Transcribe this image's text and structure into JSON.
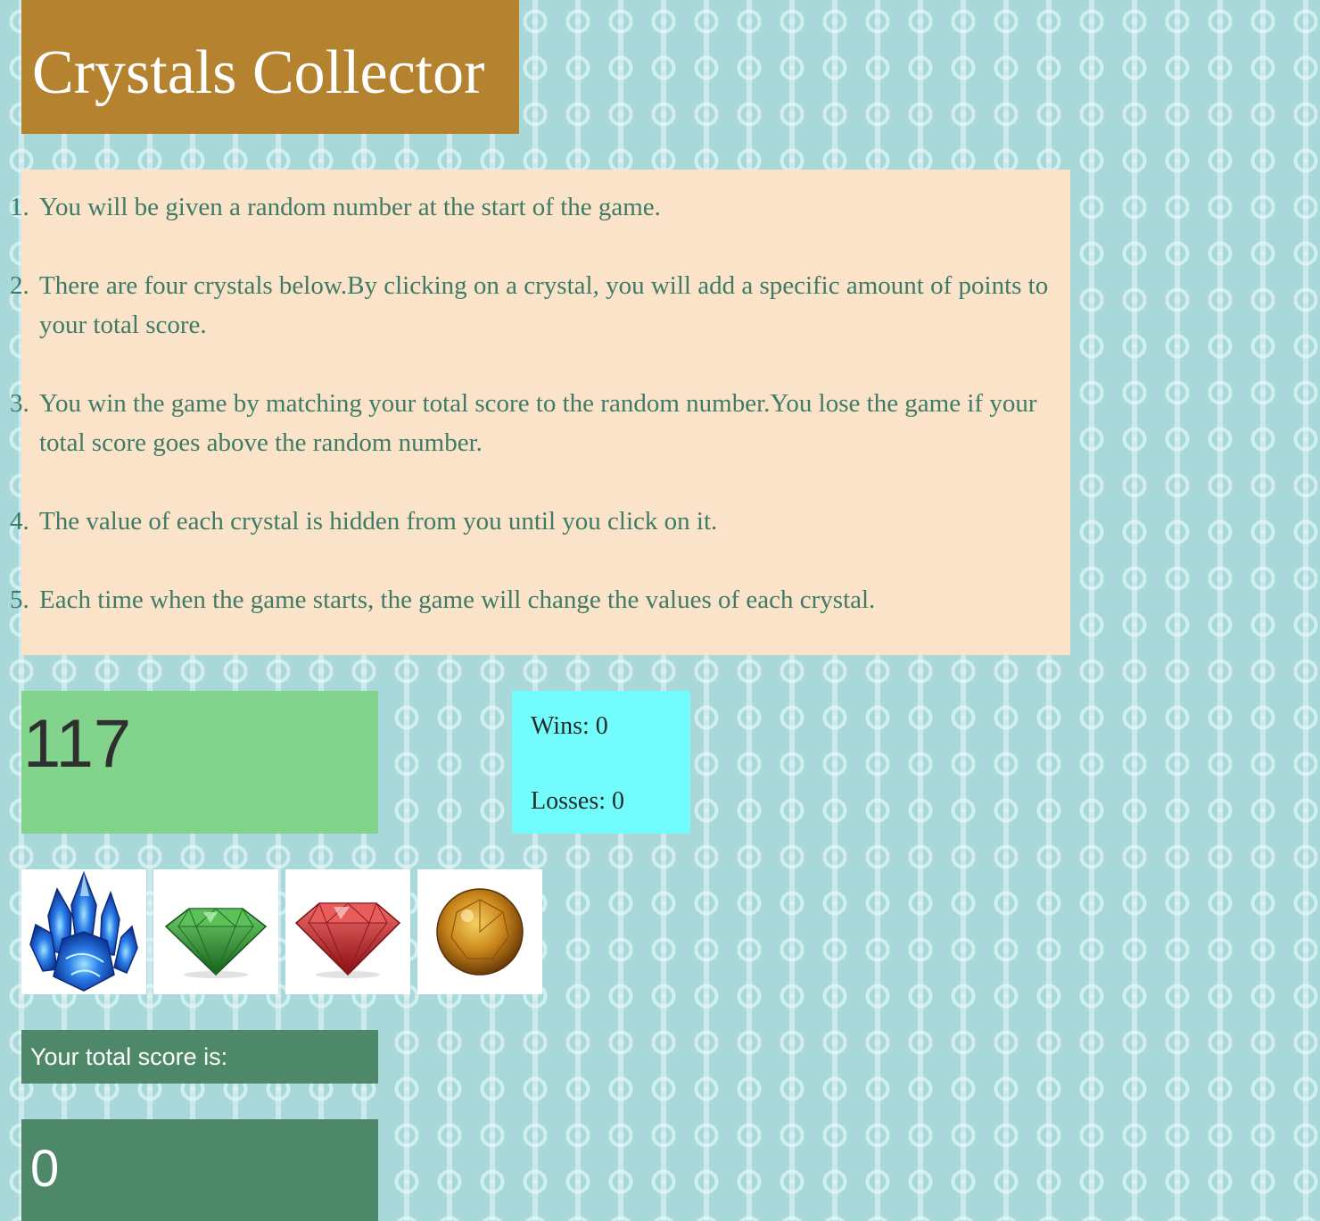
{
  "header": {
    "title": "Crystals Collector"
  },
  "rules": [
    {
      "num": "1.",
      "text": "You will be given a random number at the start of the game."
    },
    {
      "num": "2.",
      "text": "There are four crystals below.By clicking on a crystal, you will add a specific amount of points to your total score."
    },
    {
      "num": "3.",
      "text": "You win the game by matching your total score to the random number.You lose the game if your total score goes above the random number."
    },
    {
      "num": "4.",
      "text": "The value of each crystal is hidden from you until you click on it."
    },
    {
      "num": "5.",
      "text": "Each time when the game starts, the game will change the values of each crystal."
    }
  ],
  "target_number": "117",
  "stats": {
    "wins": "Wins: 0",
    "losses": "Losses: 0"
  },
  "crystals": [
    {
      "icon": "blue-crystal-icon",
      "color": "#1f63d6"
    },
    {
      "icon": "green-gem-icon",
      "color": "#2f8a34"
    },
    {
      "icon": "red-gem-icon",
      "color": "#c42a2a"
    },
    {
      "icon": "amber-gem-icon",
      "color": "#c9861a"
    }
  ],
  "score": {
    "label": "Your total score is:",
    "value": "0"
  },
  "colors": {
    "title_bg": "#b58230",
    "rules_bg": "#fae3c8",
    "rules_text": "#3e7b67",
    "target_bg": "#82d38b",
    "stats_bg": "#72fdfc",
    "score_bg": "#4d8869",
    "page_bg": "#a9d8da"
  }
}
